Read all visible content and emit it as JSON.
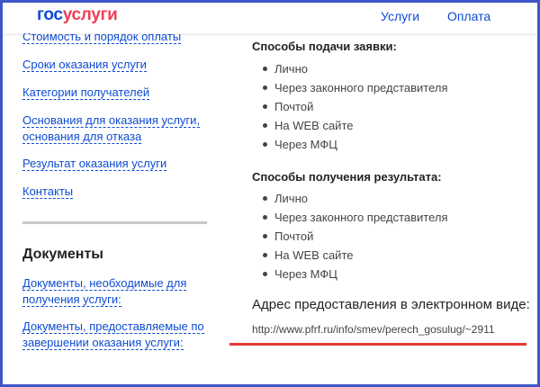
{
  "header": {
    "logo_gos": "гос",
    "logo_uslugi": "услуги",
    "nav": {
      "services": "Услуги",
      "payment": "Оплата"
    }
  },
  "sidebar": {
    "links": [
      "Стоимость и порядок оплаты",
      "Сроки оказания услуги",
      "Категории получателей",
      "Основания для оказания услуги,",
      "основания для отказа",
      "Результат оказания услуги",
      "Контакты"
    ],
    "documents_title": "Документы",
    "document_links": [
      "Документы, необходимые для",
      "получения услуги:",
      "Документы, предоставляемые по",
      "завершении оказания услуги:"
    ]
  },
  "main": {
    "submission": {
      "title": "Способы подачи заявки:",
      "items": [
        "Лично",
        "Через законного представителя",
        "Почтой",
        "На WEB сайте",
        "Через МФЦ"
      ]
    },
    "result": {
      "title": "Способы получения результата:",
      "items": [
        "Лично",
        "Через законного представителя",
        "Почтой",
        "На WEB сайте",
        "Через МФЦ"
      ]
    },
    "address_label": "Адрес предоставления в электронном виде:",
    "address_url": "http://www.pfrf.ru/info/smev/perech_gosulug/~2911"
  },
  "colors": {
    "frame_border": "#3f56c7",
    "link": "#0d4cd3",
    "brand_red": "#ee3f58",
    "highlight_red": "#e53935"
  }
}
